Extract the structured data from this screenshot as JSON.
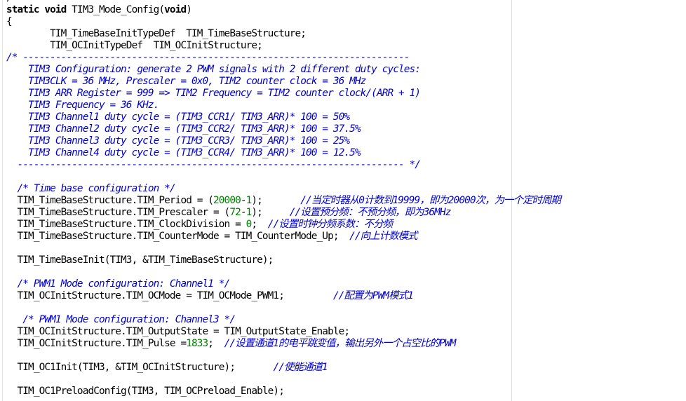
{
  "editor": {
    "colors": {
      "keyword": "#000000",
      "comment": "#0000d0",
      "number": "#008000",
      "text": "#000000"
    },
    "lines": [
      [
        {
          "t": "/",
          "c": "pl"
        }
      ],
      [
        {
          "t": "static void",
          "c": "kw"
        },
        {
          "t": " TIM3_Mode_Config(",
          "c": "pl"
        },
        {
          "t": "void",
          "c": "kw"
        },
        {
          "t": ")",
          "c": "pl"
        }
      ],
      [
        {
          "t": "{",
          "c": "pl"
        }
      ],
      [
        {
          "t": "        TIM_TimeBaseInitTypeDef  TIM_TimeBaseStructure;",
          "c": "pl"
        }
      ],
      [
        {
          "t": "        TIM_OCInitTypeDef  TIM_OCInitStructure;",
          "c": "pl"
        }
      ],
      [
        {
          "t": "/* -----------------------------------------------------------------------",
          "c": "cm"
        }
      ],
      [
        {
          "t": "    TIM3 Configuration: generate 2 PWM signals with 2 different duty cycles:",
          "c": "cm"
        }
      ],
      [
        {
          "t": "    TIM3CLK = 36 MHz, Prescaler = 0x0, TIM2 counter clock = 36 MHz",
          "c": "cm"
        }
      ],
      [
        {
          "t": "    TIM3 ARR Register = 999 => TIM2 Frequency = TIM2 counter clock/(ARR + 1)",
          "c": "cm"
        }
      ],
      [
        {
          "t": "    TIM3 Frequency = 36 KHz.",
          "c": "cm"
        }
      ],
      [
        {
          "t": "    TIM3 Channel1 duty cycle = (TIM3_CCR1/ TIM3_ARR)* 100 = 50%",
          "c": "cm"
        }
      ],
      [
        {
          "t": "    TIM3 Channel2 duty cycle = (TIM3_CCR2/ TIM3_ARR)* 100 = 37.5%",
          "c": "cm"
        }
      ],
      [
        {
          "t": "    TIM3 Channel3 duty cycle = (TIM3_CCR3/ TIM3_ARR)* 100 = 25%",
          "c": "cm"
        }
      ],
      [
        {
          "t": "    TIM3 Channel4 duty cycle = (TIM3_CCR4/ TIM3_ARR)* 100 = 12.5%",
          "c": "cm"
        }
      ],
      [
        {
          "t": "  ----------------------------------------------------------------------- */",
          "c": "cm"
        }
      ],
      [
        {
          "t": "",
          "c": "pl"
        }
      ],
      [
        {
          "t": "  ",
          "c": "pl"
        },
        {
          "t": "/* Time base configuration */",
          "c": "cm"
        }
      ],
      [
        {
          "t": "  TIM_TimeBaseStructure.TIM_Period = (",
          "c": "pl"
        },
        {
          "t": "20000",
          "c": "num"
        },
        {
          "t": "-",
          "c": "pl"
        },
        {
          "t": "1",
          "c": "num"
        },
        {
          "t": ");       ",
          "c": "pl"
        },
        {
          "t": "//当定时器从0计数到19999，即为20000次，为一个定时周期",
          "c": "cm"
        }
      ],
      [
        {
          "t": "  TIM_TimeBaseStructure.TIM_Prescaler = (",
          "c": "pl"
        },
        {
          "t": "72",
          "c": "num"
        },
        {
          "t": "-",
          "c": "pl"
        },
        {
          "t": "1",
          "c": "num"
        },
        {
          "t": ");     ",
          "c": "pl"
        },
        {
          "t": "//设置预分频：不预分频，即为36MHz",
          "c": "cm"
        }
      ],
      [
        {
          "t": "  TIM_TimeBaseStructure.TIM_ClockDivision = ",
          "c": "pl"
        },
        {
          "t": "0",
          "c": "num"
        },
        {
          "t": ";  ",
          "c": "pl"
        },
        {
          "t": "//设置时钟分频系数：不分频",
          "c": "cm"
        }
      ],
      [
        {
          "t": "  TIM_TimeBaseStructure.TIM_CounterMode = TIM_CounterMode_Up;  ",
          "c": "pl"
        },
        {
          "t": "//向上计数模式",
          "c": "cm"
        }
      ],
      [
        {
          "t": "",
          "c": "pl"
        }
      ],
      [
        {
          "t": "  TIM_TimeBaseInit(TIM3, &TIM_TimeBaseStructure);",
          "c": "pl"
        }
      ],
      [
        {
          "t": "",
          "c": "pl"
        }
      ],
      [
        {
          "t": "  ",
          "c": "pl"
        },
        {
          "t": "/* PWM1 Mode configuration: Channel1 */",
          "c": "cm"
        }
      ],
      [
        {
          "t": "  TIM_OCInitStructure.TIM_OCMode = TIM_OCMode_PWM1;         ",
          "c": "pl"
        },
        {
          "t": "//配置为PWM模式1",
          "c": "cm"
        }
      ],
      [
        {
          "t": "",
          "c": "pl"
        }
      ],
      [
        {
          "t": "   ",
          "c": "pl"
        },
        {
          "t": "/* PWM1 Mode configuration: Channel3 */",
          "c": "cm"
        }
      ],
      [
        {
          "t": "  TIM_OCInitStructure.TIM_OutputState = TIM_OutputState_Enable;",
          "c": "pl"
        }
      ],
      [
        {
          "t": "  TIM_OCInitStructure.TIM_Pulse =",
          "c": "pl"
        },
        {
          "t": "1833",
          "c": "num"
        },
        {
          "t": ";  ",
          "c": "pl"
        },
        {
          "t": "//设置通道1的电平跳变值，输出另外一个占空比的PWM",
          "c": "cm"
        }
      ],
      [
        {
          "t": "",
          "c": "pl"
        }
      ],
      [
        {
          "t": "  TIM_OC1Init(TIM3, &TIM_OCInitStructure);       ",
          "c": "pl"
        },
        {
          "t": "//使能通道1",
          "c": "cm"
        }
      ],
      [
        {
          "t": "",
          "c": "pl"
        }
      ],
      [
        {
          "t": "  TIM_OC1PreloadConfig(TIM3, TIM_OCPreload_Enable);",
          "c": "pl"
        }
      ]
    ]
  }
}
